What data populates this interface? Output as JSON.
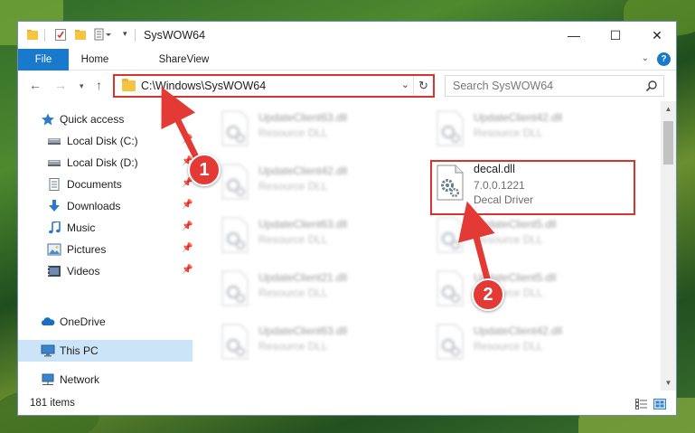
{
  "window": {
    "title": "SysWOW64",
    "minimize_label": "—",
    "maximize_label": "☐",
    "close_label": "✕"
  },
  "ribbon": {
    "tabs": [
      {
        "label": "File"
      },
      {
        "label": "Home"
      },
      {
        "label": "Share"
      },
      {
        "label": "View"
      }
    ],
    "help_label": "?"
  },
  "navbar": {
    "address": "C:\\Windows\\SysWOW64",
    "search_placeholder": "Search SysWOW64"
  },
  "sidebar": {
    "quick_access": "Quick access",
    "items": [
      {
        "label": "Local Disk (C:)",
        "icon": "drive-icon"
      },
      {
        "label": "Local Disk (D:)",
        "icon": "drive-icon"
      },
      {
        "label": "Documents",
        "icon": "documents-icon"
      },
      {
        "label": "Downloads",
        "icon": "downloads-icon"
      },
      {
        "label": "Music",
        "icon": "music-icon"
      },
      {
        "label": "Pictures",
        "icon": "pictures-icon"
      },
      {
        "label": "Videos",
        "icon": "videos-icon"
      }
    ],
    "onedrive": "OneDrive",
    "this_pc": "This PC",
    "network": "Network"
  },
  "files": {
    "left_column": [
      {
        "name": "UpdateClient63.dll",
        "type": "Resource DLL"
      },
      {
        "name": "UpdateClient42.dll",
        "type": "Resource DLL"
      },
      {
        "name": "UpdateClient63.dll",
        "type": "Resource DLL"
      },
      {
        "name": "UpdateClient21.dll",
        "type": "Resource DLL"
      },
      {
        "name": "UpdateClient63.dll",
        "type": "Resource DLL"
      }
    ],
    "right_column": [
      {
        "name": "UpdateClient42.dll",
        "type": "Resource DLL"
      },
      {
        "name": "UpdateClient5.dll",
        "type": "Resource DLL"
      },
      {
        "name": "UpdateClient5.dll",
        "type": "Resource DLL"
      },
      {
        "name": "UpdateClient42.dll",
        "type": "Resource DLL"
      }
    ],
    "highlighted": {
      "name": "decal.dll",
      "version": "7.0.0.1221",
      "description": "Decal Driver"
    }
  },
  "status": {
    "item_count": "181 items"
  },
  "annotations": {
    "callout_1": "1",
    "callout_2": "2",
    "accent_color": "#d9342b"
  }
}
